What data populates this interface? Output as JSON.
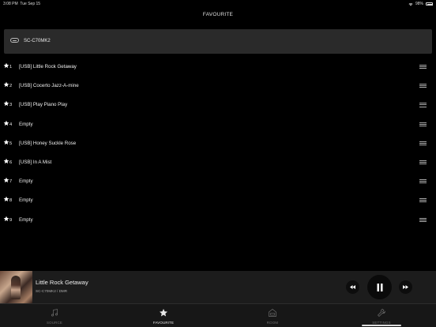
{
  "status_bar": {
    "time": "3:08 PM",
    "date": "Tue Sep 15",
    "battery": "98%"
  },
  "header": {
    "title": "FAVOURITE"
  },
  "device": {
    "name": "SC-C70MK2",
    "icon": "speaker-icon"
  },
  "favourites": [
    {
      "num": "1",
      "label": "[USB] Little Rock Getaway"
    },
    {
      "num": "2",
      "label": "[USB] Cocerto Jazz-A-mine"
    },
    {
      "num": "3",
      "label": "[USB] Play Piano Play"
    },
    {
      "num": "4",
      "label": "Empty"
    },
    {
      "num": "5",
      "label": "[USB] Honey Suckle Rose"
    },
    {
      "num": "6",
      "label": "[USB] In A Mist"
    },
    {
      "num": "7",
      "label": "Empty"
    },
    {
      "num": "8",
      "label": "Empty"
    },
    {
      "num": "9",
      "label": "Empty"
    }
  ],
  "player": {
    "track": "Little Rock Getaway",
    "subtitle": "SC-C70MK2 / DMR",
    "state": "playing"
  },
  "tabs": [
    {
      "label": "SOURCE",
      "icon": "music-note-icon",
      "active": false
    },
    {
      "label": "FAVOURITE",
      "icon": "star-icon",
      "active": true
    },
    {
      "label": "ROOM",
      "icon": "room-icon",
      "active": false
    },
    {
      "label": "SETTINGS",
      "icon": "wrench-icon",
      "active": false
    }
  ],
  "colors": {
    "background": "#000000",
    "panel": "#2a2a2a",
    "active_tab": "#e8e8e8",
    "inactive_tab": "#6f6f6f"
  }
}
